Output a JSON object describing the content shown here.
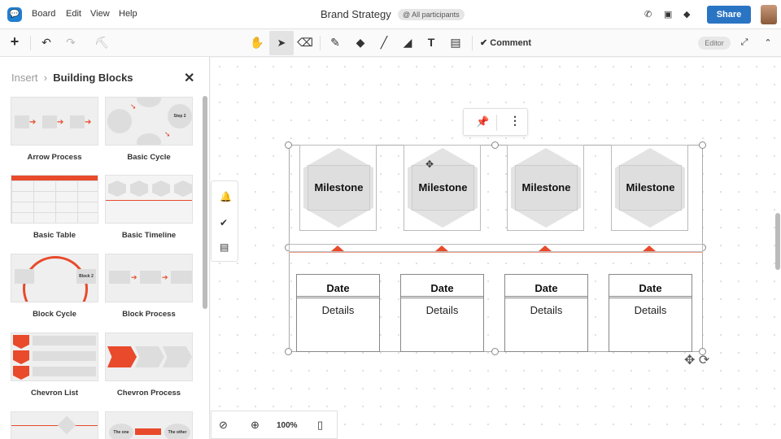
{
  "app": {
    "menu": [
      "Board",
      "Edit",
      "View",
      "Help"
    ],
    "title": "Brand Strategy",
    "participants": "@ All participants",
    "share_label": "Share",
    "editor_label": "Editor",
    "comment_label": "Comment"
  },
  "panel": {
    "crumb_parent": "Insert",
    "crumb_current": "Building Blocks",
    "blocks": [
      {
        "label": "Arrow Process"
      },
      {
        "label": "Basic Cycle"
      },
      {
        "label": "Basic Table"
      },
      {
        "label": "Basic Timeline"
      },
      {
        "label": "Block Cycle"
      },
      {
        "label": "Block Process"
      },
      {
        "label": "Chevron List"
      },
      {
        "label": "Chevron Process"
      }
    ],
    "thumb_text": {
      "step": "Step 2",
      "block": "Block 2",
      "the_one": "The one",
      "the_other": "The other"
    }
  },
  "canvas": {
    "milestones": [
      "Milestone",
      "Milestone",
      "Milestone",
      "Milestone"
    ],
    "dates": [
      "Date",
      "Date",
      "Date",
      "Date"
    ],
    "details": [
      "Details",
      "Details",
      "Details",
      "Details"
    ]
  },
  "zoom": "100%",
  "colors": {
    "accent": "#e84a2b",
    "brand": "#2a74c4"
  }
}
